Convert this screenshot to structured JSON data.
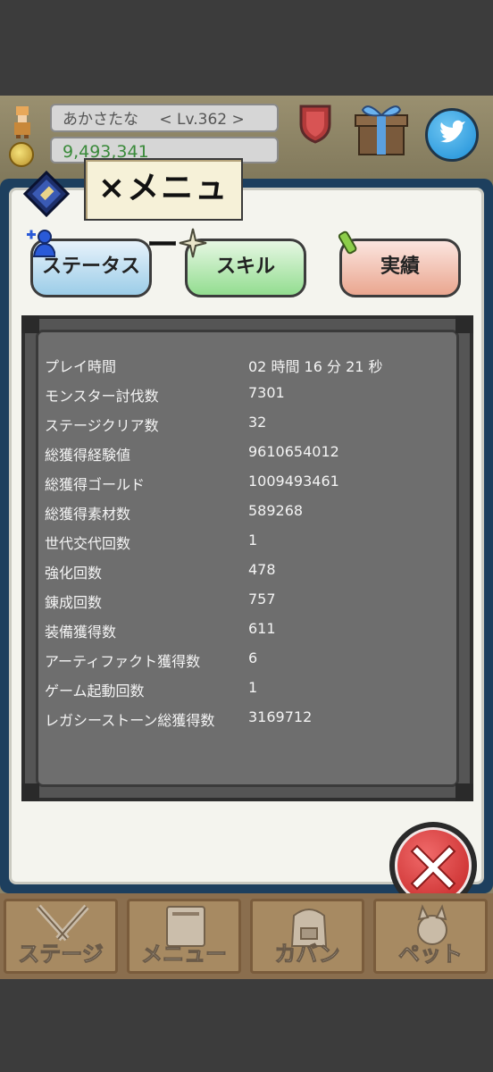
{
  "hud": {
    "player_name": "あかさたな",
    "level": "< Lv.362 >",
    "gold": "9,493,341"
  },
  "menu": {
    "title": "メニュー",
    "tabs": [
      "ステータス",
      "スキル",
      "実績"
    ]
  },
  "stats": [
    {
      "label": "プレイ時間",
      "value": "02 時間 16 分 21 秒"
    },
    {
      "label": "モンスター討伐数",
      "value": "7301"
    },
    {
      "label": "ステージクリア数",
      "value": "32"
    },
    {
      "label": "総獲得経験値",
      "value": "9610654012"
    },
    {
      "label": "総獲得ゴールド",
      "value": "1009493461"
    },
    {
      "label": "総獲得素材数",
      "value": "589268"
    },
    {
      "label": "世代交代回数",
      "value": "1"
    },
    {
      "label": "強化回数",
      "value": "478"
    },
    {
      "label": "錬成回数",
      "value": "757"
    },
    {
      "label": "装備獲得数",
      "value": "611"
    },
    {
      "label": "アーティファクト獲得数",
      "value": "6"
    },
    {
      "label": "ゲーム起動回数",
      "value": "1"
    },
    {
      "label": "レガシーストーン総獲得数",
      "value": "3169712"
    }
  ],
  "bottom_nav": [
    "ステージ",
    "メニュー",
    "カバン",
    "ペット"
  ],
  "icons": {
    "hero": "hero-sprite-icon",
    "coin": "coin-icon",
    "shield": "shield-icon",
    "gift": "gift-box-icon",
    "twitter": "twitter-bird-icon",
    "book": "book-icon",
    "status": "person-plus-icon",
    "skill": "sparkle-icon",
    "record": "scroll-icon",
    "close": "close-x-icon"
  },
  "colors": {
    "panel_border": "#1d3f5e",
    "board": "#6e6e6e",
    "close": "#c42424"
  }
}
